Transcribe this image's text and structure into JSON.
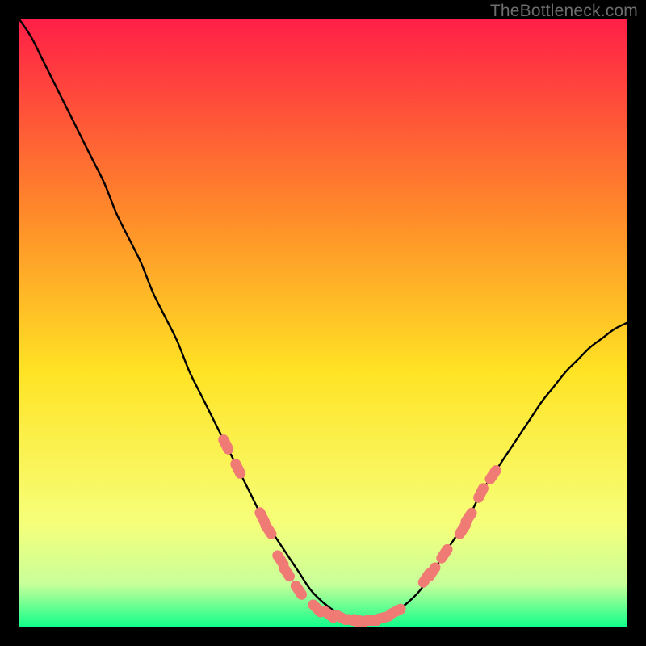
{
  "watermark": "TheBottleneck.com",
  "colors": {
    "frame": "#000000",
    "gradient_top": "#ff1f47",
    "gradient_mid_upper": "#ff8a2a",
    "gradient_mid": "#ffe324",
    "gradient_lower": "#f6ff7a",
    "gradient_near_bottom": "#c8ff9a",
    "gradient_bottom": "#12ff8a",
    "curve": "#000000",
    "markers": "#ef7b74"
  },
  "chart_data": {
    "type": "line",
    "title": "",
    "xlabel": "",
    "ylabel": "",
    "xlim": [
      0,
      100
    ],
    "ylim": [
      0,
      100
    ],
    "grid": false,
    "legend": false,
    "series": [
      {
        "name": "bottleneck-curve",
        "x": [
          0,
          2,
          4,
          6,
          8,
          10,
          12,
          14,
          16,
          18,
          20,
          22,
          24,
          26,
          28,
          30,
          32,
          34,
          36,
          38,
          40,
          42,
          44,
          46,
          48,
          50,
          52,
          54,
          56,
          58,
          60,
          62,
          64,
          66,
          68,
          70,
          72,
          74,
          76,
          78,
          80,
          82,
          84,
          86,
          88,
          90,
          92,
          94,
          96,
          98,
          100
        ],
        "y": [
          100,
          97,
          93,
          89,
          85,
          81,
          77,
          73,
          68,
          64,
          60,
          55,
          51,
          47,
          42,
          38,
          34,
          30,
          26,
          22,
          18,
          15,
          12,
          9,
          6,
          4,
          2.5,
          1.5,
          1,
          1,
          1.5,
          2.5,
          4,
          6,
          9,
          12,
          15,
          18,
          22,
          25,
          28,
          31,
          34,
          37,
          39.5,
          42,
          44,
          46,
          47.5,
          49,
          50
        ]
      }
    ],
    "markers": [
      {
        "x": 34,
        "y": 30
      },
      {
        "x": 36,
        "y": 26
      },
      {
        "x": 40,
        "y": 18
      },
      {
        "x": 41,
        "y": 16
      },
      {
        "x": 43,
        "y": 11
      },
      {
        "x": 44,
        "y": 9
      },
      {
        "x": 46,
        "y": 6
      },
      {
        "x": 49,
        "y": 3
      },
      {
        "x": 51,
        "y": 2
      },
      {
        "x": 53,
        "y": 1.5
      },
      {
        "x": 55,
        "y": 1
      },
      {
        "x": 56,
        "y": 1
      },
      {
        "x": 58,
        "y": 1
      },
      {
        "x": 60,
        "y": 1.5
      },
      {
        "x": 62,
        "y": 2.5
      },
      {
        "x": 67,
        "y": 8
      },
      {
        "x": 68,
        "y": 9
      },
      {
        "x": 70,
        "y": 12
      },
      {
        "x": 73,
        "y": 16
      },
      {
        "x": 74,
        "y": 18
      },
      {
        "x": 76,
        "y": 22
      },
      {
        "x": 78,
        "y": 25
      }
    ]
  }
}
